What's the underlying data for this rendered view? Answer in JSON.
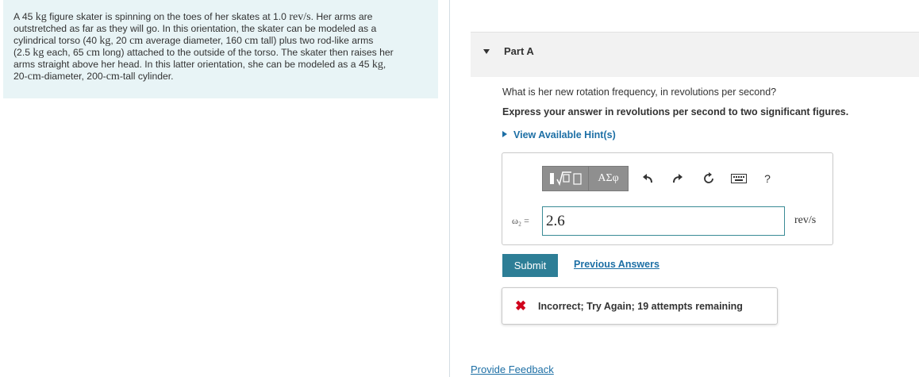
{
  "problem": {
    "lines": [
      [
        "A 45 ",
        "kg",
        " figure skater is spinning on the toes of her skates at 1.0 ",
        "rev/s",
        ". Her arms are"
      ],
      [
        "outstretched as far as they will go. In this orientation, the skater can be modeled as a"
      ],
      [
        "cylindrical torso (40 ",
        "kg",
        ", 20 ",
        "cm",
        " average diameter, 160 ",
        "cm",
        " tall) plus two rod-like arms"
      ],
      [
        "(2.5 ",
        "kg",
        " each, 65 ",
        "cm",
        " long) attached to the outside of the torso. The skater then raises her"
      ],
      [
        "arms straight above her head. In this latter orientation, she can be modeled as a 45 ",
        "kg",
        ","
      ],
      [
        "20-",
        "cm",
        "-diameter, 200-",
        "cm",
        "-tall cylinder."
      ]
    ]
  },
  "part": {
    "title": "Part A"
  },
  "question": "What is her new rotation frequency, in revolutions per second?",
  "instruction": "Express your answer in revolutions per second to two significant figures.",
  "hint_label": "View Available Hint(s)",
  "toolbar": {
    "template_button": "",
    "greek_button": "ΑΣφ",
    "undo_icon": "undo-icon",
    "redo_icon": "redo-icon",
    "reset_icon": "reset-icon",
    "keyboard_icon": "keyboard-icon",
    "help_label": "?"
  },
  "answer": {
    "variable_label": "ω₂ =",
    "value": "2.6",
    "unit": "rev/s"
  },
  "submit_label": "Submit",
  "previous_answers_label": "Previous Answers",
  "feedback": {
    "icon": "x-icon",
    "text": "Incorrect; Try Again; 19 attempts remaining",
    "color": "#d0021b"
  },
  "provide_feedback_label": "Provide Feedback",
  "colors": {
    "problem_bg": "#e8f4f6",
    "accent": "#2d7e96",
    "link": "#1d6fa5"
  }
}
